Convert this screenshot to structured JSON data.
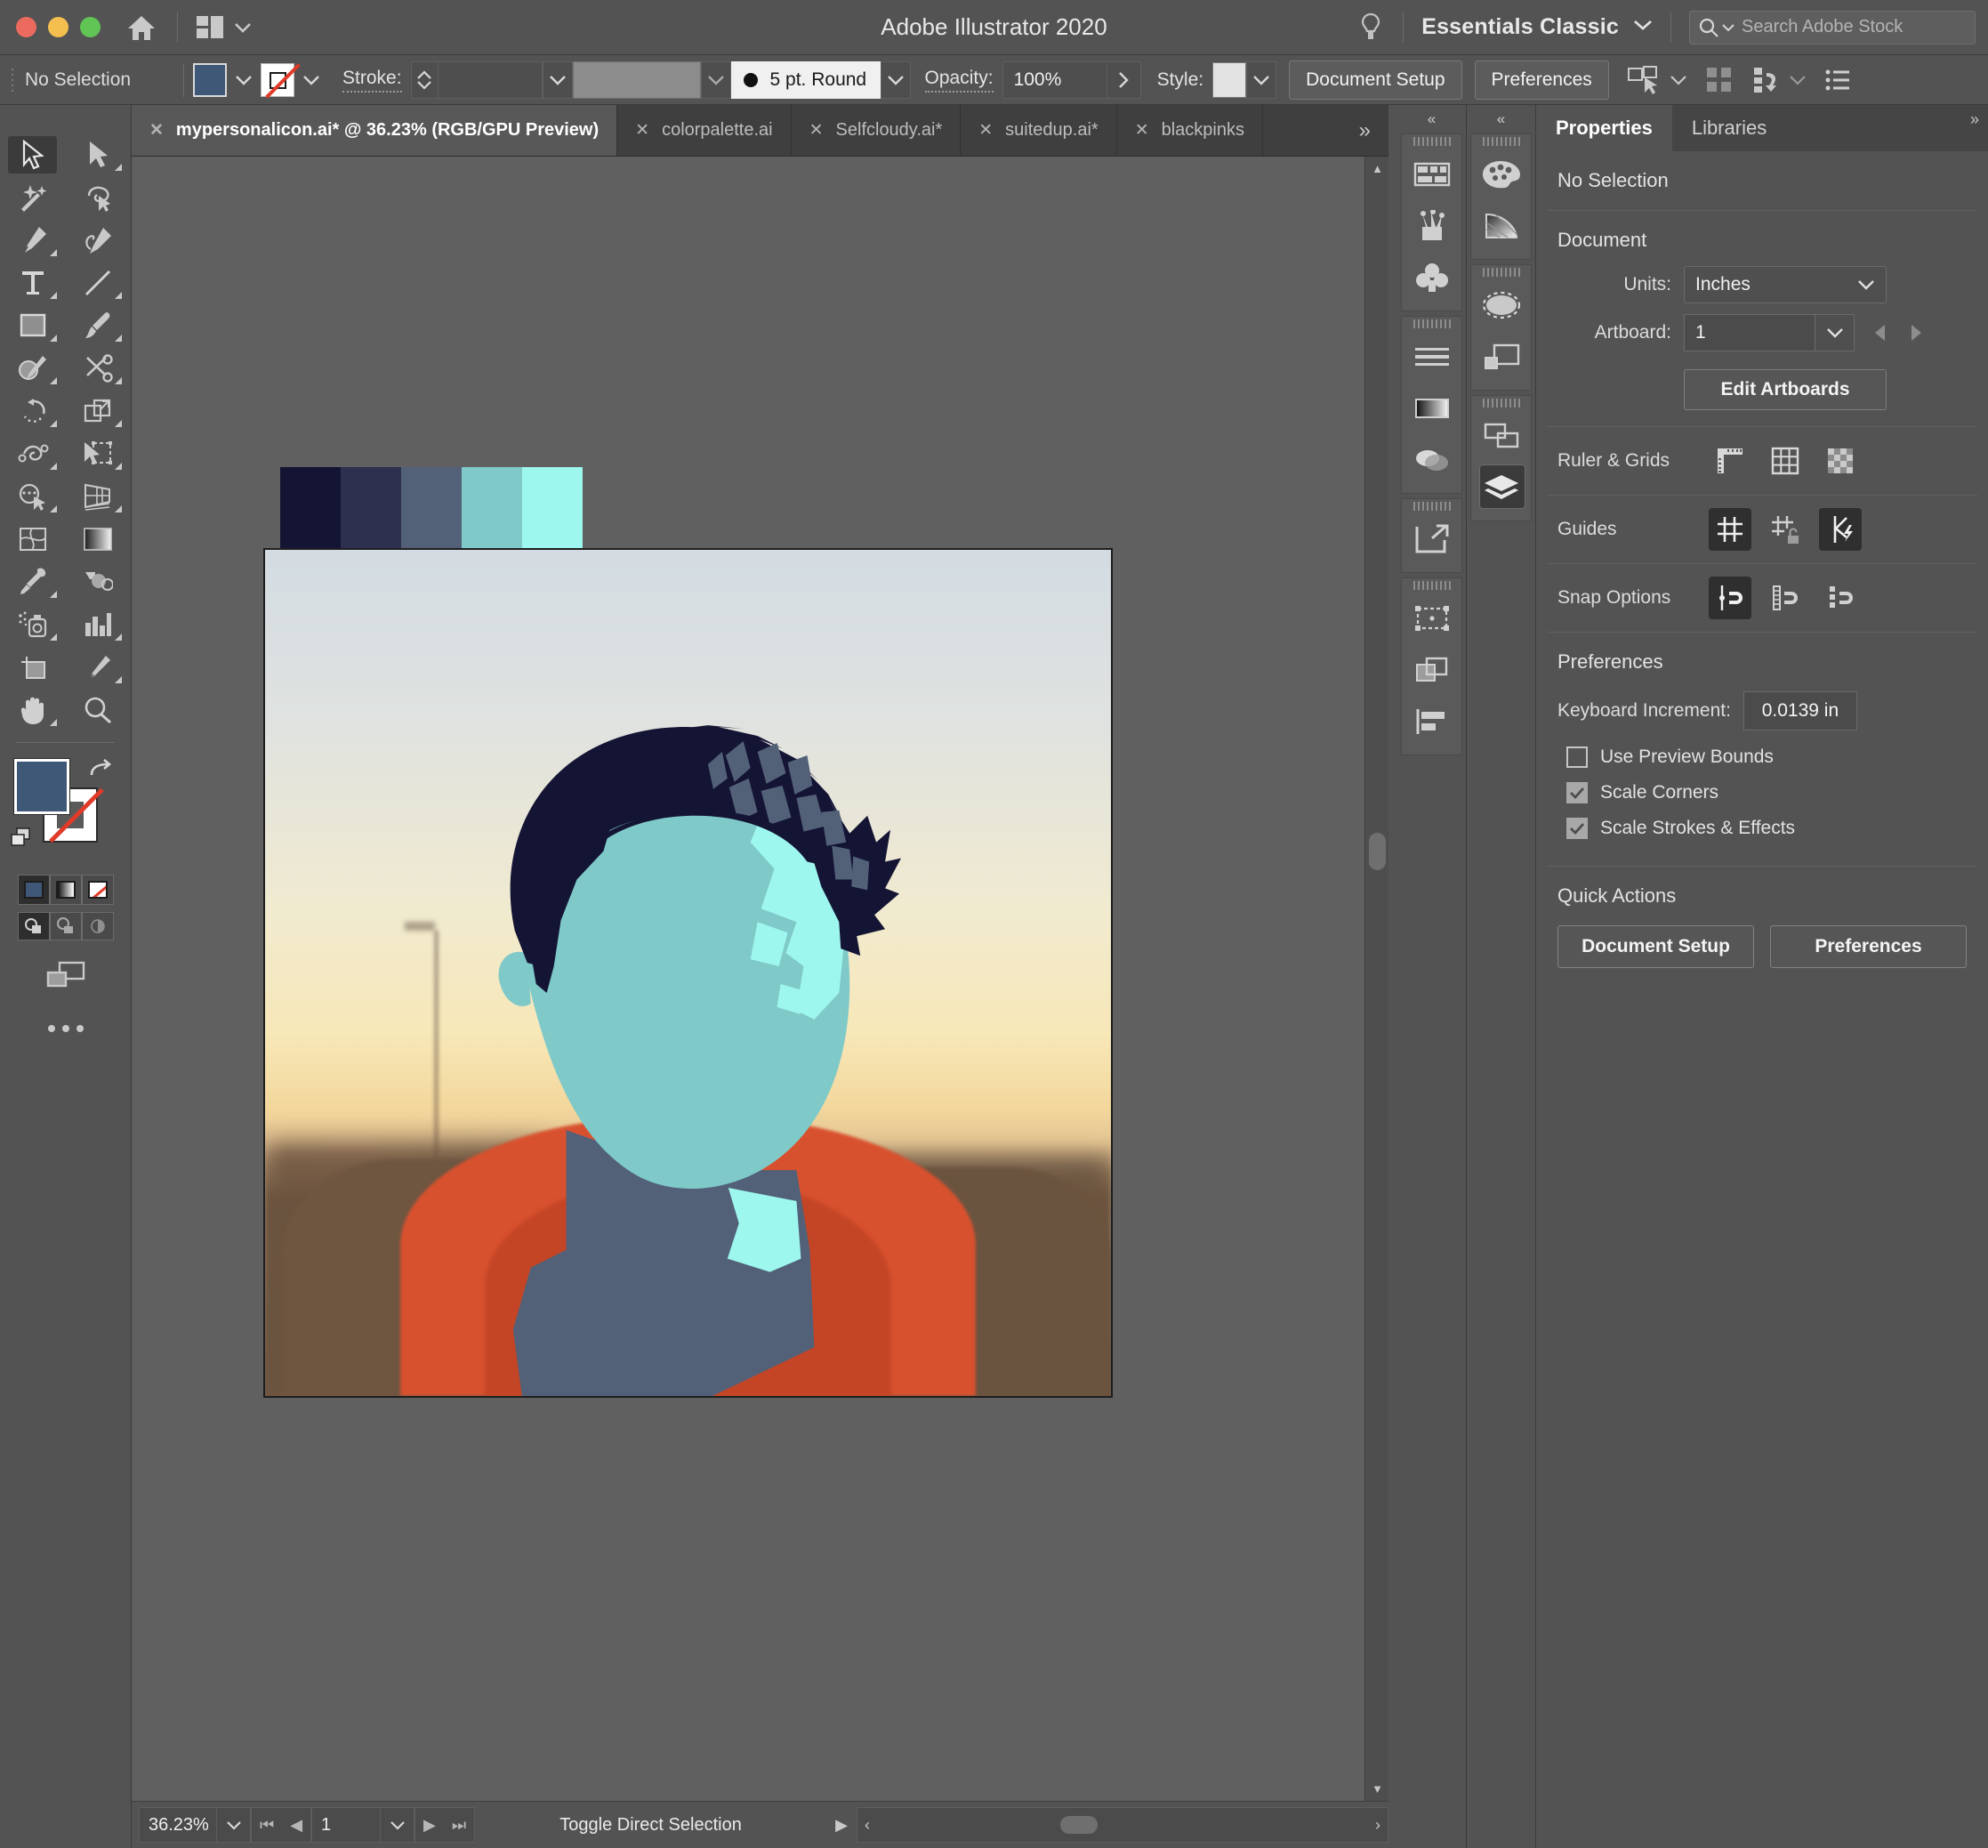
{
  "titlebar": {
    "app_title": "Adobe Illustrator 2020",
    "home_icon": "home-icon",
    "arrange_icon": "arrange-documents-icon",
    "bulb_icon": "lightbulb-icon",
    "workspace": "Essentials Classic",
    "search_placeholder": "Search Adobe Stock",
    "traffic": [
      "close",
      "minimize",
      "maximize"
    ]
  },
  "controlbar": {
    "selection_status": "No Selection",
    "fill_color": "#3f5878",
    "stroke_color": "none",
    "stroke_label": "Stroke:",
    "stroke_weight": "",
    "brush_definition": "5 pt. Round",
    "opacity_label": "Opacity:",
    "opacity_value": "100%",
    "style_label": "Style:",
    "document_setup": "Document Setup",
    "preferences": "Preferences",
    "icons": [
      "select-similar-icon",
      "align-icon",
      "distribute-icon",
      "options-list-icon"
    ]
  },
  "tabs": [
    {
      "label": "mypersonalicon.ai* @ 36.23% (RGB/GPU Preview)",
      "active": true
    },
    {
      "label": "colorpalette.ai",
      "active": false
    },
    {
      "label": "Selfcloudy.ai*",
      "active": false
    },
    {
      "label": "suitedup.ai*",
      "active": false
    },
    {
      "label": "blackpinks",
      "active": false
    }
  ],
  "tab_overflow": "»",
  "toolbar": {
    "tools": [
      {
        "name": "selection-tool",
        "selected": true,
        "corner": false
      },
      {
        "name": "direct-selection-tool",
        "selected": false,
        "corner": true
      },
      {
        "name": "magic-wand-tool",
        "selected": false,
        "corner": false
      },
      {
        "name": "lasso-tool",
        "selected": false,
        "corner": false
      },
      {
        "name": "pen-tool",
        "selected": false,
        "corner": true
      },
      {
        "name": "curvature-tool",
        "selected": false,
        "corner": false
      },
      {
        "name": "type-tool",
        "selected": false,
        "corner": true
      },
      {
        "name": "line-segment-tool",
        "selected": false,
        "corner": true
      },
      {
        "name": "rectangle-tool",
        "selected": false,
        "corner": true
      },
      {
        "name": "paintbrush-tool",
        "selected": false,
        "corner": true
      },
      {
        "name": "shaper-tool",
        "selected": false,
        "corner": true
      },
      {
        "name": "scissors-tool",
        "selected": false,
        "corner": true
      },
      {
        "name": "rotate-tool",
        "selected": false,
        "corner": true
      },
      {
        "name": "scale-tool",
        "selected": false,
        "corner": true
      },
      {
        "name": "width-tool",
        "selected": false,
        "corner": true
      },
      {
        "name": "free-transform-tool",
        "selected": false,
        "corner": true
      },
      {
        "name": "shape-builder-tool",
        "selected": false,
        "corner": true
      },
      {
        "name": "perspective-grid-tool",
        "selected": false,
        "corner": true
      },
      {
        "name": "mesh-tool",
        "selected": false,
        "corner": false
      },
      {
        "name": "gradient-tool",
        "selected": false,
        "corner": false
      },
      {
        "name": "eyedropper-tool",
        "selected": false,
        "corner": true
      },
      {
        "name": "blend-tool",
        "selected": false,
        "corner": false
      },
      {
        "name": "symbol-sprayer-tool",
        "selected": false,
        "corner": true
      },
      {
        "name": "column-graph-tool",
        "selected": false,
        "corner": true
      },
      {
        "name": "artboard-tool",
        "selected": false,
        "corner": false
      },
      {
        "name": "slice-tool",
        "selected": false,
        "corner": true
      },
      {
        "name": "hand-tool",
        "selected": false,
        "corner": true
      },
      {
        "name": "zoom-tool",
        "selected": false,
        "corner": false
      }
    ],
    "fill_color": "#3f5878",
    "stroke_color": "none",
    "color_modes": [
      "color-fill-mode",
      "gradient-mode",
      "none-mode"
    ],
    "draw_modes": [
      "draw-normal",
      "draw-behind",
      "draw-inside"
    ],
    "screen_mode": "change-screen-mode-icon",
    "more_tools": "edit-toolbar-icon"
  },
  "canvas": {
    "swatches": [
      "#141434",
      "#2e3050",
      "#526178",
      "#7fc9c9",
      "#9ef7ef"
    ],
    "artwork": {
      "hair_dark": "#141434",
      "hair_mid": "#526178",
      "face": "#7fc9c9",
      "highlight": "#9ef7ef",
      "neck": "#526178"
    }
  },
  "dock_a": {
    "collapse": "«",
    "groups": [
      {
        "icons": [
          "swatches-panel-icon",
          "brushes-panel-icon",
          "symbols-panel-icon"
        ]
      },
      {
        "icons": [
          "stroke-panel-icon",
          "gradient-panel-icon",
          "transparency-panel-icon"
        ]
      },
      {
        "icons": [
          "asset-export-panel-icon"
        ]
      },
      {
        "icons": [
          "transform-panel-icon",
          "pathfinder-panel-icon",
          "align-panel-icon"
        ]
      }
    ]
  },
  "dock_b": {
    "collapse": "«",
    "groups": [
      {
        "icons": [
          "color-panel-icon",
          "color-guide-panel-icon"
        ]
      },
      {
        "icons": [
          "appearance-panel-icon",
          "graphic-styles-panel-icon"
        ]
      },
      {
        "icons": [
          "artboards-panel-icon",
          "layers-panel-icon"
        ]
      }
    ],
    "active_icon": "layers-panel-icon"
  },
  "properties": {
    "tabs": [
      {
        "label": "Properties",
        "active": true
      },
      {
        "label": "Libraries",
        "active": false
      }
    ],
    "selection_status": "No Selection",
    "document": {
      "section_title": "Document",
      "units_label": "Units:",
      "units_value": "Inches",
      "artboard_label": "Artboard:",
      "artboard_value": "1",
      "edit_artboards": "Edit Artboards"
    },
    "ruler_grids": {
      "label": "Ruler & Grids",
      "icons": [
        "show-rulers-icon",
        "show-grid-icon",
        "show-transparency-grid-icon"
      ]
    },
    "guides": {
      "label": "Guides",
      "icons": [
        "show-guides-icon",
        "lock-guides-icon",
        "smart-guides-icon"
      ],
      "active": [
        0,
        2
      ]
    },
    "snap_options": {
      "label": "Snap Options",
      "icons": [
        "snap-to-point-icon",
        "snap-to-grid-icon",
        "snap-to-pixel-icon"
      ],
      "active": [
        0
      ]
    },
    "preferences": {
      "section_title": "Preferences",
      "keyboard_increment_label": "Keyboard Increment:",
      "keyboard_increment_value": "0.0139 in",
      "checkboxes": [
        {
          "label": "Use Preview Bounds",
          "checked": false
        },
        {
          "label": "Scale Corners",
          "checked": true
        },
        {
          "label": "Scale Strokes & Effects",
          "checked": true
        }
      ]
    },
    "quick_actions": {
      "section_title": "Quick Actions",
      "buttons": [
        "Document Setup",
        "Preferences"
      ]
    }
  },
  "statusbar": {
    "zoom": "36.23%",
    "page": "1",
    "status_text": "Toggle Direct Selection",
    "nav_first": "⏮",
    "nav_prev": "◀",
    "nav_next": "▶",
    "nav_last": "⏭"
  }
}
